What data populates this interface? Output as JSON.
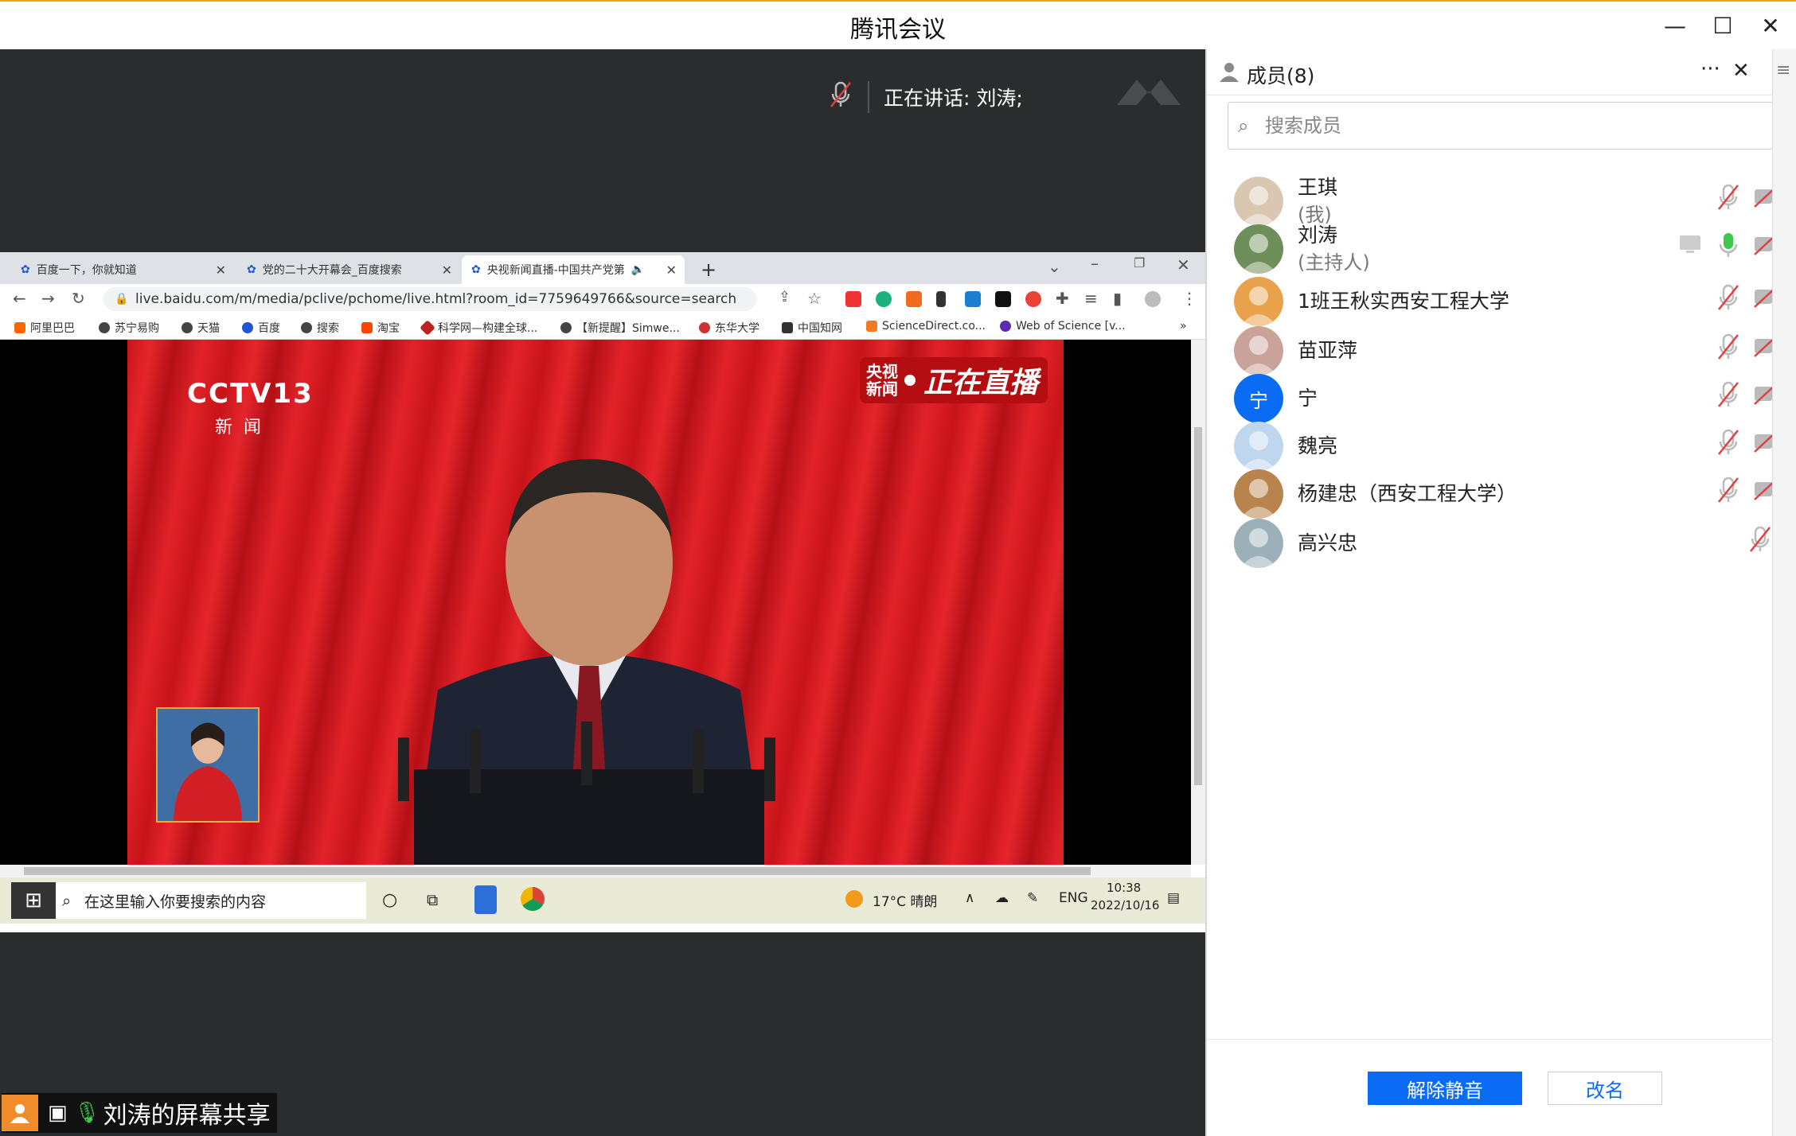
{
  "window": {
    "title": "腾讯会议",
    "minimize_glyph": "—",
    "maximize_glyph": "☐",
    "close_glyph": "✕"
  },
  "meeting": {
    "speaking_label": "正在讲话: 刘涛;",
    "share_label": "刘涛的屏幕共享"
  },
  "browser": {
    "tabs": [
      {
        "title": "百度一下，你就知道"
      },
      {
        "title": "党的二十大开幕会_百度搜索"
      },
      {
        "title": "央视新闻直播-中国共产党第"
      }
    ],
    "new_tab": "+",
    "url": "live.baidu.com/m/media/pclive/pchome/live.html?room_id=7759649766&source=search",
    "bookmarks": [
      "阿里巴巴",
      "苏宁易购",
      "天猫",
      "百度",
      "搜索",
      "淘宝",
      "科学网—构建全球...",
      "【新提醒】Simwe...",
      "东华大学",
      "中国知网",
      "ScienceDirect.co...",
      "Web of Science [v..."
    ],
    "bookmarks_more": "»"
  },
  "video": {
    "channel_logo": "CCTV13",
    "channel_sub": "新闻",
    "badge_left": "央视新闻",
    "badge_right": "正在直播"
  },
  "taskbar": {
    "search_placeholder": "在这里输入你要搜索的内容",
    "weather": "17°C 晴朗",
    "lang": "ENG",
    "time": "10:38",
    "date": "2022/10/16"
  },
  "members_panel": {
    "title": "成员(8)",
    "more_glyph": "···",
    "close_glyph": "✕",
    "search_placeholder": "搜索成员",
    "members": [
      {
        "name": "王琪",
        "role": "(我)",
        "avatar_color": "#d9c7b2"
      },
      {
        "name": "刘涛",
        "role": "(主持人)",
        "avatar_color": "#6f8f5a"
      },
      {
        "name": "1班王秋实西安工程大学",
        "avatar_color": "#e9a24b"
      },
      {
        "name": "苗亚萍",
        "avatar_color": "#c9a39a"
      },
      {
        "name": "宁",
        "avatar_text": "宁",
        "avatar_color": "#0a6cf5"
      },
      {
        "name": "魏亮",
        "avatar_color": "#bfd6ef"
      },
      {
        "name": "杨建忠（西安工程大学）",
        "avatar_color": "#b8834c"
      },
      {
        "name": "高兴忠",
        "avatar_color": "#9bb0b8"
      }
    ],
    "unmute_label": "解除静音",
    "rename_label": "改名"
  },
  "colors": {
    "accent": "#0a6cf5",
    "mic_active": "#3cc84a",
    "muted_red": "#e04040"
  }
}
